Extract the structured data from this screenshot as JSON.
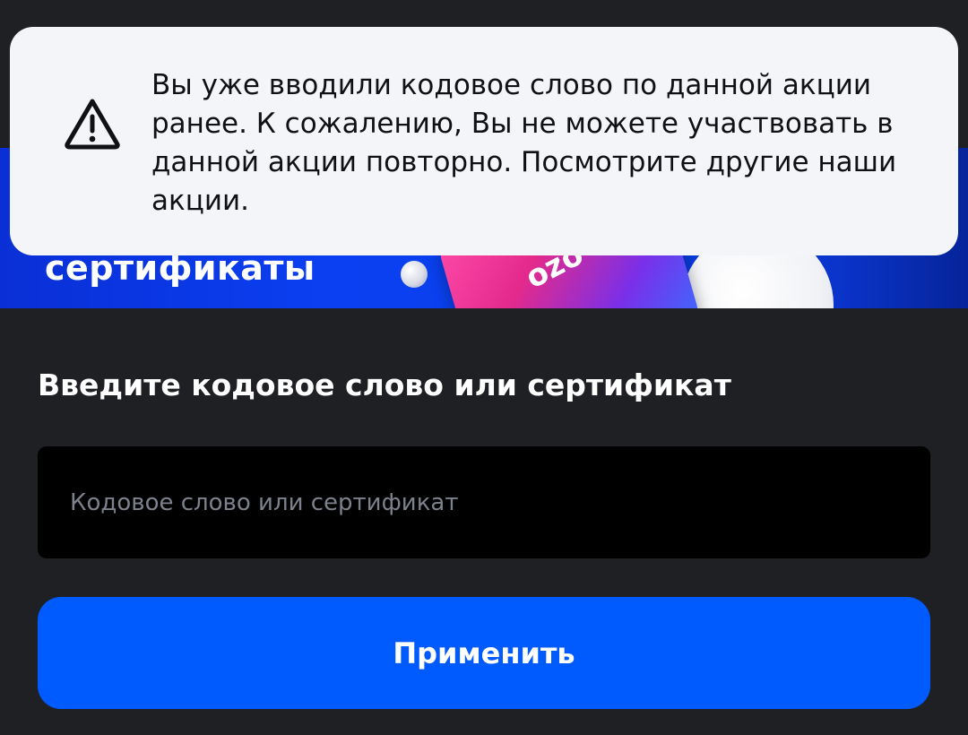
{
  "colors": {
    "background": "#1f2024",
    "toast_background": "#f3f5f9",
    "accent": "#005bff",
    "input_background": "#000000",
    "banner": "#0b40f2"
  },
  "banner": {
    "label": "сертификаты",
    "card_logo": "ozo"
  },
  "toast": {
    "icon": "warning-icon",
    "message": "Вы уже вводили кодовое слово по данной акции ранее. К сожалению, Вы не можете участвовать в данной акции повторно. Посмотрите другие наши акции."
  },
  "form": {
    "title": "Введите кодовое слово или сертификат",
    "input": {
      "value": "",
      "placeholder": "Кодовое слово или сертификат"
    },
    "apply_label": "Применить"
  }
}
